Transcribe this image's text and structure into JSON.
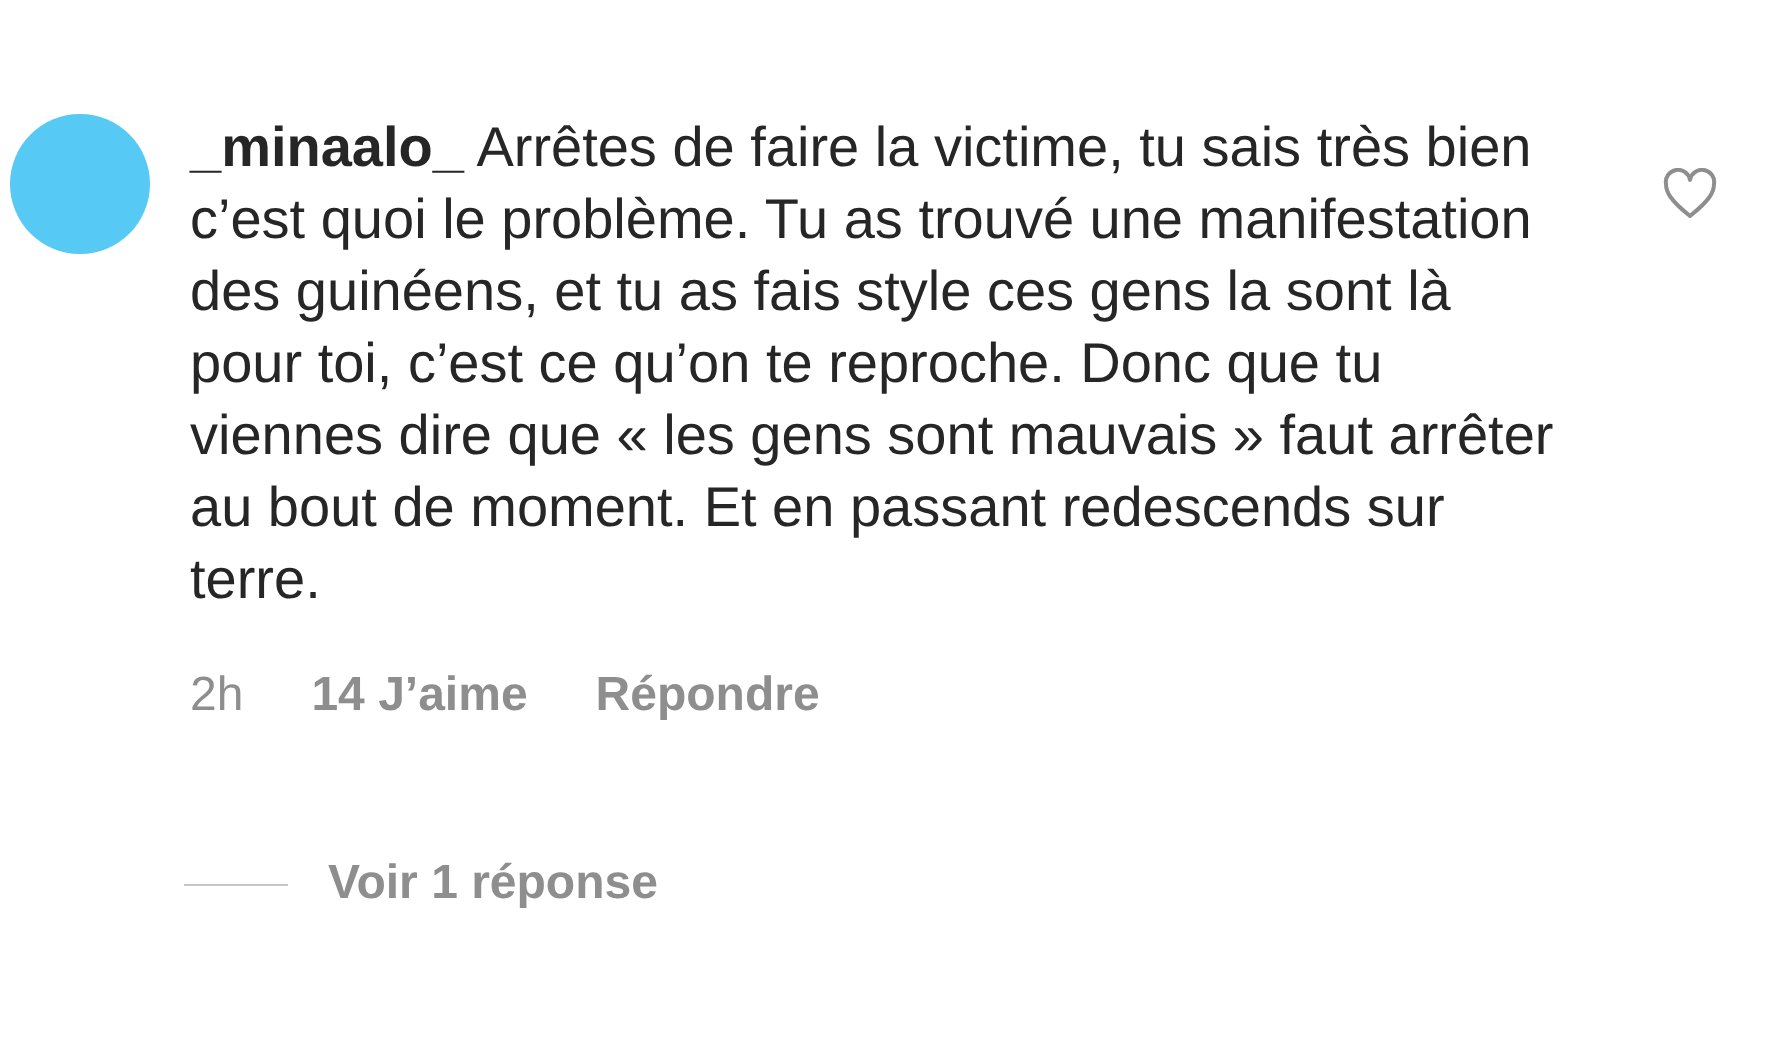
{
  "comment": {
    "username": "_minaalo_",
    "text": "Arrêtes de faire la victime, tu sais très bien c’est quoi le problème. Tu as trouvé une manifestation des guinéens, et tu as fais style ces gens la sont là pour toi, c’est ce qu’on te reproche. Donc que tu viennes dire que « les gens sont mauvais » faut arrêter au bout de moment. Et en passant redescends sur terre.",
    "liked": false,
    "time": "2h",
    "likes": "14 J’aime",
    "reply": "Répondre",
    "view_replies": "Voir 1 réponse"
  }
}
